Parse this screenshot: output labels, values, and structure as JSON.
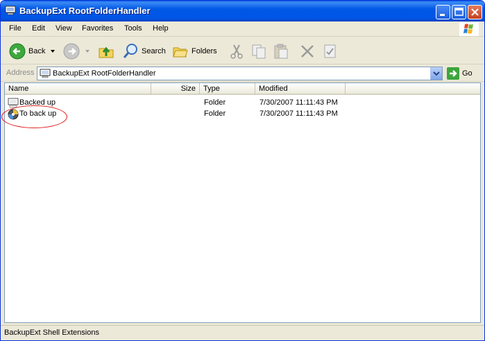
{
  "window": {
    "title": "BackupExt RootFolderHandler"
  },
  "menu": [
    "File",
    "Edit",
    "View",
    "Favorites",
    "Tools",
    "Help"
  ],
  "toolbar": {
    "back_label": "Back",
    "search_label": "Search",
    "folders_label": "Folders"
  },
  "address": {
    "label": "Address",
    "value": "BackupExt RootFolderHandler",
    "go_label": "Go"
  },
  "columns": {
    "name": "Name",
    "size": "Size",
    "type": "Type",
    "modified": "Modified"
  },
  "files": [
    {
      "name": "Backed up",
      "size": "",
      "type": "Folder",
      "modified": "7/30/2007 11:11:43 PM"
    },
    {
      "name": "To back up",
      "size": "",
      "type": "Folder",
      "modified": "7/30/2007 11:11:43 PM"
    }
  ],
  "status": {
    "text": "BackupExt Shell Extensions"
  }
}
